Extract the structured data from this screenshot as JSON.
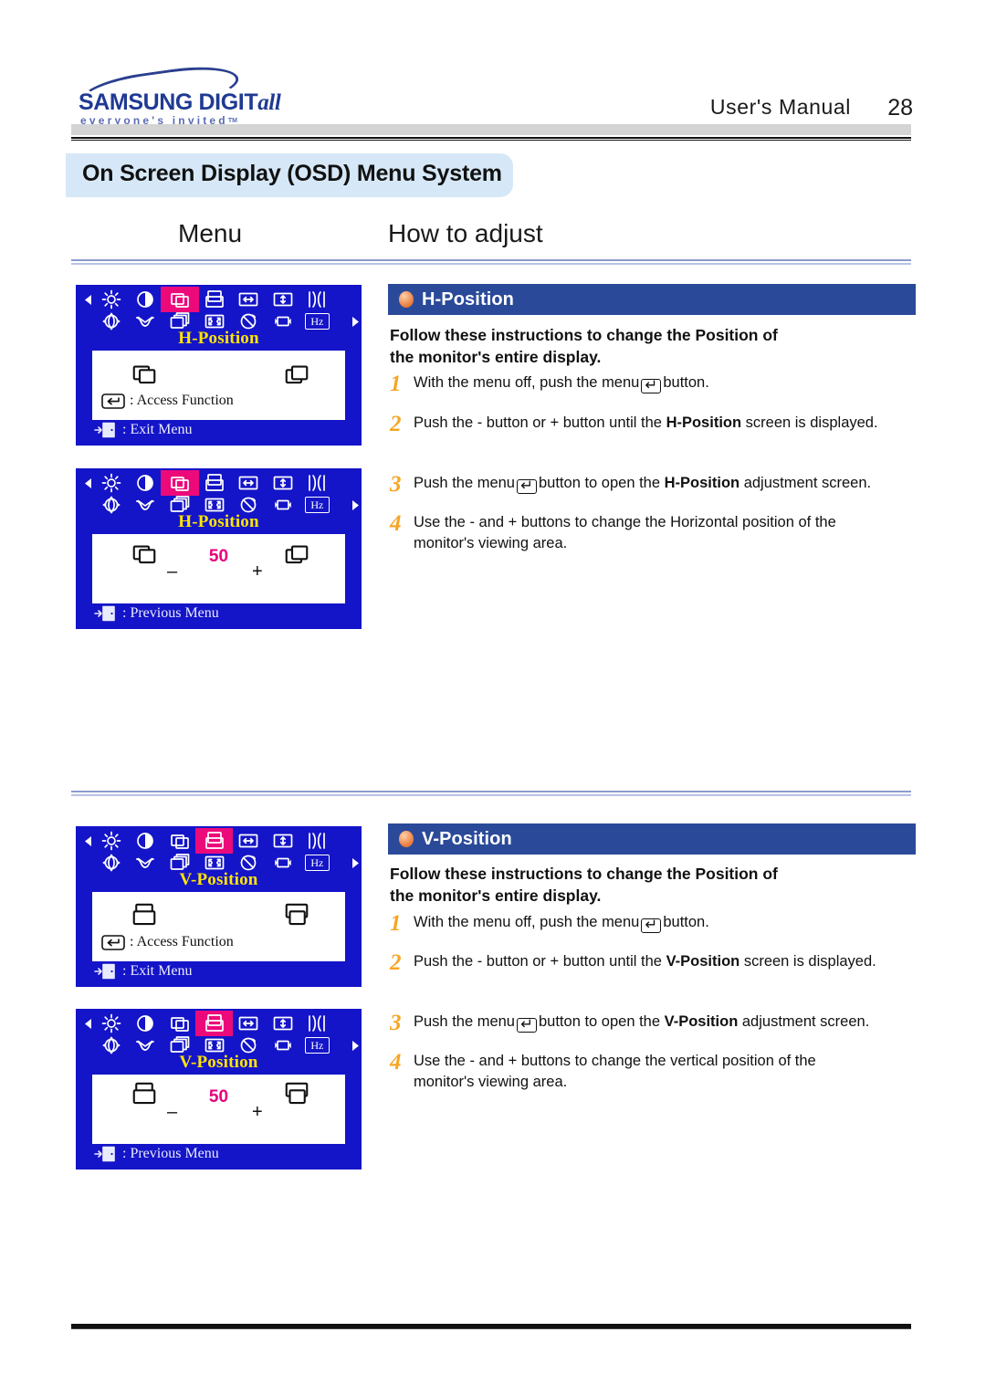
{
  "header": {
    "logo_main": "SAMSUNG DIGIT",
    "logo_main_italic": "all",
    "logo_sub": "everyone's invited",
    "logo_tm": "TM",
    "manual_label": "User's Manual",
    "page_number": "28"
  },
  "section": {
    "title": "On Screen Display (OSD) Menu System",
    "col_menu": "Menu",
    "col_howto": "How to adjust"
  },
  "osd_icons": {
    "row1": [
      "brightness-icon",
      "contrast-icon",
      "h-position-icon",
      "v-position-icon",
      "h-size-icon",
      "v-size-icon",
      "pincushion-icon"
    ],
    "row2": [
      "rotation-icon",
      "trapezoid-icon",
      "zoom-icon",
      "corner-icon",
      "degauss-icon",
      "screen-position-icon",
      "frequency-icon"
    ],
    "frequency_label": "Hz",
    "left_arrow": "left-arrow-icon",
    "right_arrow": "right-arrow-icon"
  },
  "osd_panels": [
    {
      "id": "h-position-menu",
      "menu_title": "H-Position",
      "highlight_index": 2,
      "highlight_row": 1,
      "access_line": ": Access Function",
      "footer_line": ": Exit Menu",
      "value": null,
      "minus": "–",
      "plus": "+",
      "left_icon": "h-position-icon",
      "right_icon": "h-position-icon"
    },
    {
      "id": "h-position-adjust",
      "menu_title": "H-Position",
      "highlight_index": 2,
      "highlight_row": 1,
      "access_line": null,
      "footer_line": ": Previous Menu",
      "value": "50",
      "minus": "–",
      "plus": "+",
      "left_icon": "h-position-icon",
      "right_icon": "h-position-icon"
    },
    {
      "id": "v-position-menu",
      "menu_title": "V-Position",
      "highlight_index": 3,
      "highlight_row": 1,
      "access_line": ": Access Function",
      "footer_line": ": Exit Menu",
      "value": null,
      "minus": "–",
      "plus": "+",
      "left_icon": "v-position-icon",
      "right_icon": "v-position-icon"
    },
    {
      "id": "v-position-adjust",
      "menu_title": "V-Position",
      "highlight_index": 3,
      "highlight_row": 1,
      "access_line": null,
      "footer_line": ": Previous Menu",
      "value": "50",
      "minus": "–",
      "plus": "+",
      "left_icon": "v-position-icon",
      "right_icon": "v-position-icon"
    }
  ],
  "sections": [
    {
      "id": "h-position",
      "bar_label": "H-Position",
      "lead_line1": "Follow these instructions to change the  Position of",
      "lead_line2": "the monitor's entire display.",
      "steps": [
        {
          "n": "1",
          "pre": "With the menu off, push the menu",
          "key": "↵",
          "post": "button."
        },
        {
          "n": "2",
          "pre": "Push the  - button or  + button until the ",
          "bold": "H-Position",
          "post": " screen is displayed."
        },
        {
          "n": "3",
          "pre": "Push the menu",
          "key": "↵",
          "mid": "button to open the ",
          "bold": "H-Position",
          "post": " adjustment screen."
        },
        {
          "n": "4",
          "pre": "Use the  - and  + buttons to change the Horizontal position of the monitor's viewing area."
        }
      ]
    },
    {
      "id": "v-position",
      "bar_label": "V-Position",
      "lead_line1": "Follow these instructions to change the  Position of",
      "lead_line2": "the monitor's entire display.",
      "steps": [
        {
          "n": "1",
          "pre": "With the menu off, push the menu",
          "key": "↵",
          "post": "button."
        },
        {
          "n": "2",
          "pre": "Push the  - button or  + button until the ",
          "bold": "V-Position",
          "post": "  screen is displayed."
        },
        {
          "n": "3",
          "pre": "Push the menu",
          "key": "↵",
          "mid": "button to open the ",
          "bold": "V-Position",
          "post": " adjustment screen."
        },
        {
          "n": "4",
          "pre": "Use the  - and  + buttons to change the vertical position of the monitor's viewing area."
        }
      ]
    }
  ],
  "colors": {
    "osd_blue": "#1414c8",
    "osd_highlight": "#ec0a7b",
    "osd_title_yellow": "#ffe400",
    "section_bar_blue": "#2a4a99",
    "title_bar_blue": "#d6e8f7",
    "step_number_orange": "#f5a623",
    "brand_blue": "#1f3a93"
  }
}
